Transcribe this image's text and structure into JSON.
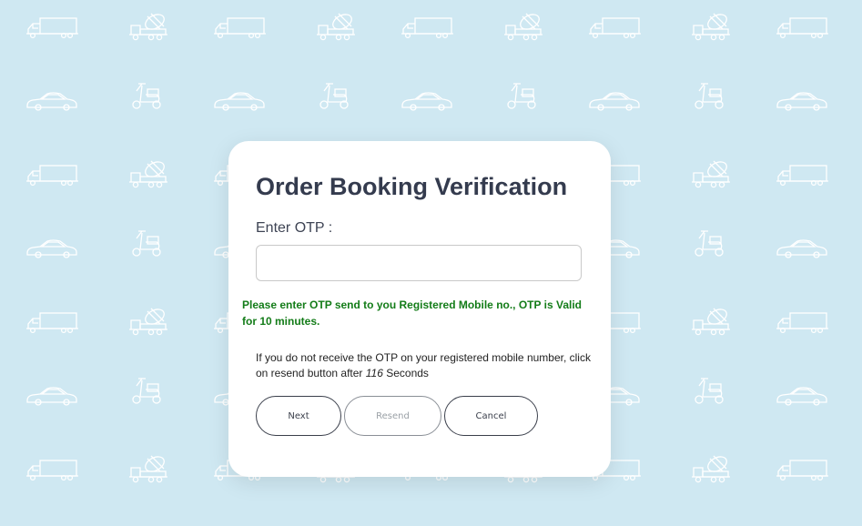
{
  "background": {
    "color": "#cfe8f2",
    "pattern_icons": [
      "truck-icon",
      "concrete-mixer-icon",
      "car-icon",
      "scooter-icon"
    ]
  },
  "form": {
    "title": "Order Booking Verification",
    "otp_label": "Enter OTP :",
    "otp_value": "",
    "otp_placeholder": "",
    "validity_message": "Please enter OTP send to you Registered Mobile no., OTP is Valid for 10 minutes.",
    "resend_info_prefix": "If you do not receive the OTP on your registered mobile number, click on resend button after ",
    "resend_seconds": "116",
    "resend_info_suffix": " Seconds",
    "buttons": {
      "next": "Next",
      "resend": "Resend",
      "cancel": "Cancel"
    },
    "colors": {
      "validity_message": "#137c18",
      "title": "#343b4e"
    }
  }
}
